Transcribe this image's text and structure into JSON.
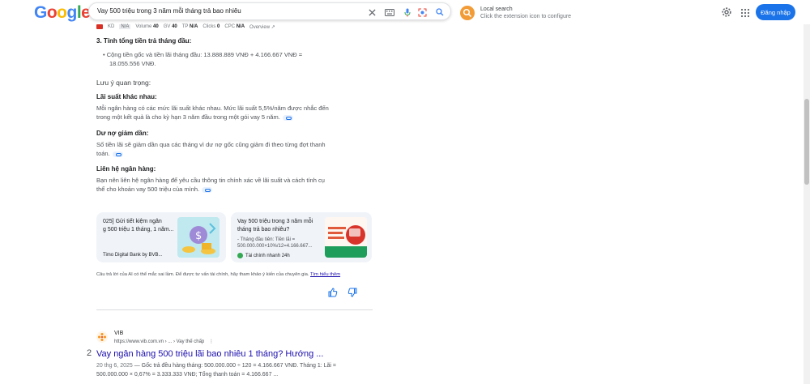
{
  "header": {
    "logo": [
      "G",
      "o",
      "o",
      "g",
      "l",
      "e"
    ],
    "logo_colors": [
      "#4285f4",
      "#ea4335",
      "#fbbc05",
      "#4285f4",
      "#34a853",
      "#ea4335"
    ],
    "search_query": "Vay 500 triệu trong 3 năm mỗi tháng trả bao nhiêu",
    "extension_title": "Local search",
    "extension_subtitle": "Click the extension icon to configure",
    "signin_label": "Đăng nhập"
  },
  "seo_bar": {
    "kd_label": "KD",
    "kd_value": "N/A",
    "volume_label": "Volume",
    "volume_value": "40",
    "gv_label": "GV",
    "gv_value": "40",
    "tp_label": "TP",
    "tp_value": "N/A",
    "clicks_label": "Clicks",
    "clicks_value": "0",
    "cpc_label": "CPC",
    "cpc_value": "N/A",
    "overview_label": "Overview"
  },
  "ai_overview": {
    "step3_heading": "3. Tính tổng tiền trả tháng đầu:",
    "step3_bullet_line1": "Cộng tiền gốc và tiền lãi tháng đầu: 13.888.889 VNĐ + 4.166.667 VNĐ =",
    "step3_bullet_line2": "18.055.556 VNĐ.",
    "note_heading": "Lưu ý quan trọng:",
    "items": [
      {
        "heading": "Lãi suất khác nhau:",
        "line1": "Mỗi ngân hàng có các mức lãi suất khác nhau. Mức lãi suất 5,5%/năm được nhắc đến",
        "line2": "trong một kết quả là cho kỳ hạn 3 năm đầu trong một gói vay 5 năm."
      },
      {
        "heading": "Dư nợ giảm dần:",
        "line1": "Số tiền lãi sẽ giảm dần qua các tháng vì dư nợ gốc cũng giảm đi theo từng đợt thanh",
        "line2": "toán."
      },
      {
        "heading": "Liên hệ ngân hàng:",
        "line1": "Bạn nên liên hệ ngân hàng để yêu cầu thông tin chính xác về lãi suất và cách tính cụ",
        "line2": "thể cho khoản vay 500 triệu của mình."
      }
    ],
    "cards": [
      {
        "title_line1": "025] Gửi tiết kiệm ngân",
        "title_line2": "g 500 triệu 1 tháng, 1 năm...",
        "snippet_line1": "",
        "snippet_line2": "",
        "source": "Timo Digital Bank by BVB..."
      },
      {
        "title_line1": "Vay 500 triệu trong 3 năm mỗi",
        "title_line2": "tháng trả bao nhiêu?",
        "snippet_line1": "- Tháng đầu tiên: Tiền lãi =",
        "snippet_line2": "500.000.000×10%/12=4.166.667...",
        "source": "Tài chính nhanh 24h"
      }
    ],
    "disclaimer": "Câu trả lời của AI có thể mắc sai lầm. Để được tư vấn tài chính, hãy tham khảo ý kiến của chuyên gia.",
    "learn_more": "Tìm hiểu thêm"
  },
  "result": {
    "site_name": "VIB",
    "url": "https://www.vib.com.vn › ... › Vay thế chấp",
    "number": "2",
    "title": "Vay ngân hàng 500 triệu lãi bao nhiêu 1 tháng? Hướng ...",
    "date": "20 thg 6, 2025",
    "snippet_line1": " — Gốc trả đều hàng tháng: 500.000.000 ÷ 120 = 4.166.667 VNĐ. Tháng 1: Lãi =",
    "snippet_line2": "500.000.000 × 0,67% = 3.333.333 VNĐ; Tổng thanh toán = 4.166.667 ..."
  }
}
